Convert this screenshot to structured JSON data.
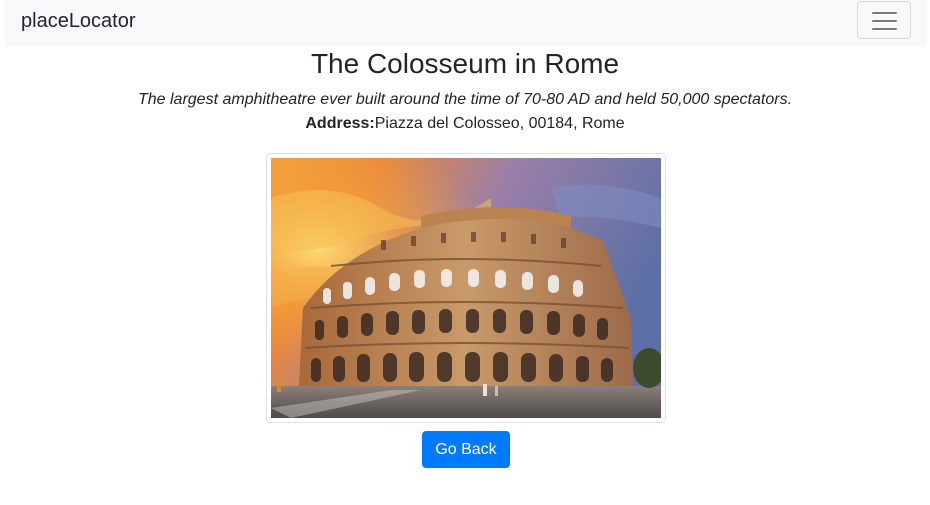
{
  "navbar": {
    "brand": "placeLocator",
    "toggler_icon": "hamburger-menu-icon"
  },
  "place": {
    "title": "The Colosseum in Rome",
    "description": "The largest amphitheatre ever built around the time of 70-80 AD and held 50,000 spectators.",
    "address_label": "Address:",
    "address_value": "Piazza del Colosseo, 00184, Rome",
    "image_subject": "Colosseum at sunset"
  },
  "actions": {
    "back_label": "Go Back"
  },
  "colors": {
    "primary": "#007bff",
    "navbar_bg": "#f8f9fa",
    "text": "#212529"
  }
}
